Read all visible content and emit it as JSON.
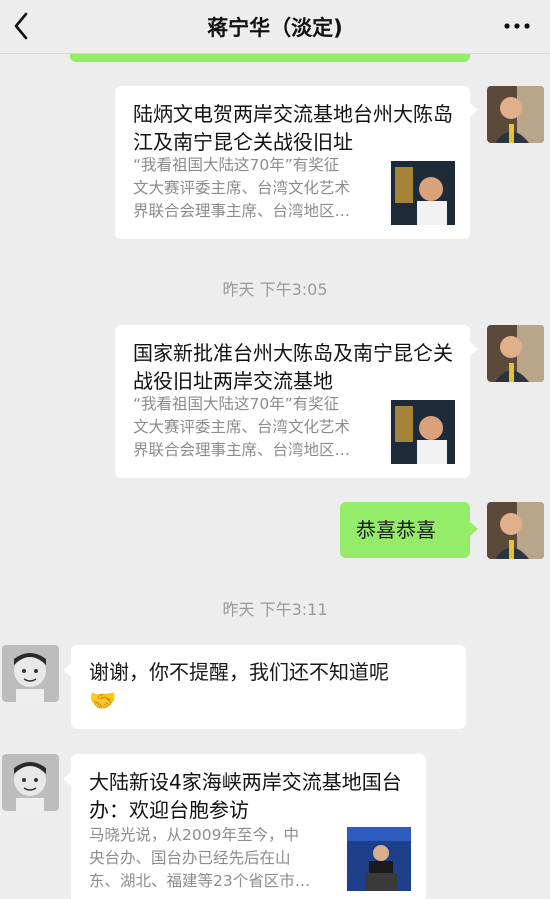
{
  "header": {
    "title": "蒋宁华（淡定)"
  },
  "messages": {
    "card1": {
      "title": "陆炳文电贺两岸交流基地台州大陈岛江及南宁昆仑关战役旧址",
      "desc_line1": "“我看祖国大陆这70年”有奖征",
      "desc_line2": "文大赛评委主席、台湾文化艺术",
      "desc_line3": "界联合会理事主席、台湾地区…"
    },
    "time1": "昨天 下午3:05",
    "card2": {
      "title": "国家新批准台州大陈岛及南宁昆仑关战役旧址两岸交流基地",
      "desc_line1": "“我看祖国大陆这70年”有奖征",
      "desc_line2": "文大赛评委主席、台湾文化艺术",
      "desc_line3": "界联合会理事主席、台湾地区…"
    },
    "bubble1": "恭喜恭喜",
    "time2": "昨天 下午3:11",
    "bubble2": "谢谢，你不提醒，我们还不知道呢",
    "bubble2_emoji": "🤝",
    "card3": {
      "title": "大陆新设4家海峡两岸交流基地国台办：欢迎台胞参访",
      "desc_line1": "马晓光说，从2009年至今，中",
      "desc_line2": "央台办、国台办已经先后在山",
      "desc_line3": "东、湖北、福建等23个省区市…"
    }
  },
  "colors": {
    "sent_bubble": "#95ec69",
    "received_bubble": "#ffffff",
    "background": "#ededed"
  }
}
